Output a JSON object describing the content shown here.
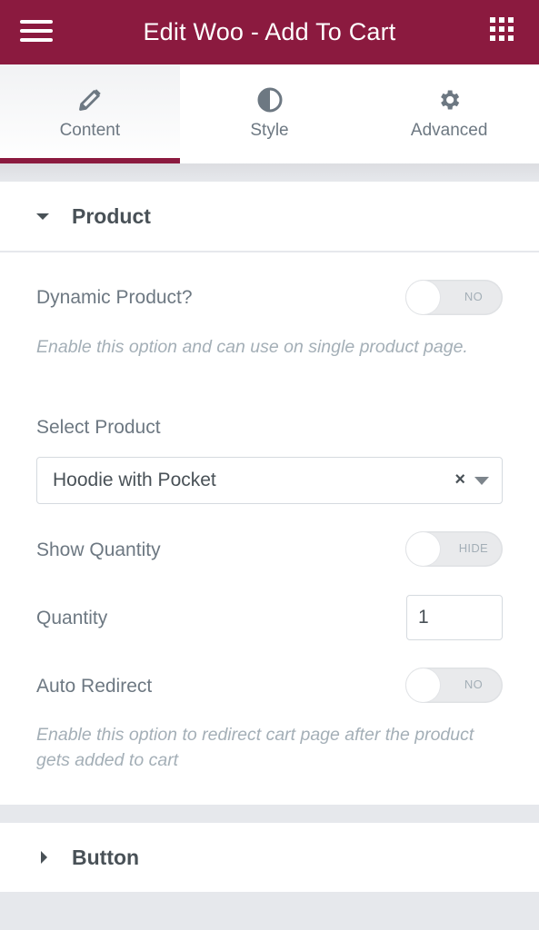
{
  "header": {
    "title": "Edit Woo - Add To Cart",
    "menu_icon": "hamburger-icon",
    "widgets_icon": "grid-icon"
  },
  "tabs": [
    {
      "label": "Content",
      "icon": "pencil-icon",
      "active": true
    },
    {
      "label": "Style",
      "icon": "half-circle-icon",
      "active": false
    },
    {
      "label": "Advanced",
      "icon": "gear-icon",
      "active": false
    }
  ],
  "sections": {
    "product": {
      "title": "Product",
      "expanded": true,
      "dynamic_product": {
        "label": "Dynamic Product?",
        "toggle_text": "NO",
        "value": false,
        "description": "Enable this option and can use on single product page."
      },
      "select_product": {
        "label": "Select Product",
        "value": "Hoodie with Pocket",
        "clear": "×"
      },
      "show_quantity": {
        "label": "Show Quantity",
        "toggle_text": "HIDE",
        "value": false
      },
      "quantity": {
        "label": "Quantity",
        "value": "1"
      },
      "auto_redirect": {
        "label": "Auto Redirect",
        "toggle_text": "NO",
        "value": false,
        "description": "Enable this option to redirect cart page after the product gets added to cart"
      }
    },
    "button": {
      "title": "Button",
      "expanded": false
    }
  },
  "colors": {
    "accent": "#8b1a3f",
    "text": "#6d7882",
    "heading": "#495157",
    "muted": "#a4afb7"
  }
}
